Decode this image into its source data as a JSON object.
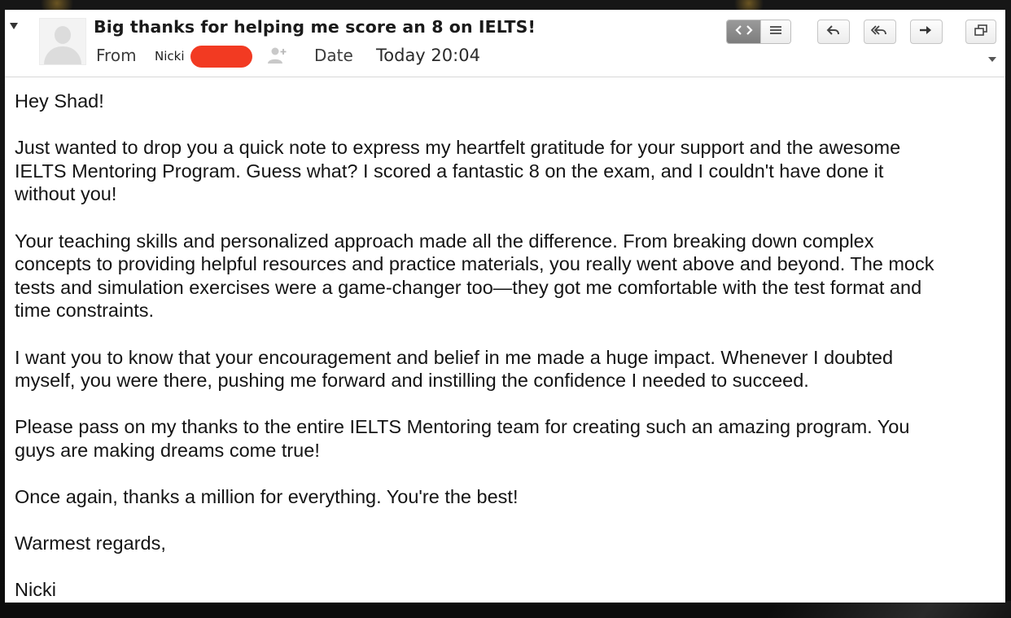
{
  "email": {
    "subject": "Big thanks for helping me score an 8 on IELTS!",
    "from_label": "From",
    "from_name": "Nicki",
    "date_label": "Date",
    "date_value": "Today 20:04"
  },
  "toolbar": {
    "buttons": [
      {
        "name": "toggle-source-view",
        "icon": "code-brackets-icon"
      },
      {
        "name": "view-menu",
        "icon": "hamburger-icon"
      },
      {
        "name": "reply",
        "icon": "reply-icon"
      },
      {
        "name": "reply-all",
        "icon": "reply-all-icon"
      },
      {
        "name": "forward",
        "icon": "forward-arrow-icon"
      },
      {
        "name": "open-in-window",
        "icon": "windows-icon"
      }
    ]
  },
  "message": {
    "paragraphs": [
      "Hey Shad!",
      "Just wanted to drop you a quick note to express my heartfelt gratitude for your support and the awesome\nIELTS Mentoring Program. Guess what? I scored a fantastic 8 on the exam, and I couldn't have done it\nwithout you!",
      "Your teaching skills and personalized approach made all the difference. From breaking down complex\nconcepts to providing helpful resources and practice materials, you really went above and beyond. The mock\ntests and simulation exercises were a game-changer too—they got me comfortable with the test format and\ntime constraints.",
      "I want you to know that your encouragement and belief in me made a huge impact. Whenever I doubted\nmyself, you were there, pushing me forward and instilling the confidence I needed to succeed.",
      "Please pass on my thanks to the entire IELTS Mentoring team for creating such an amazing program. You\nguys are making dreams come true!",
      "Once again, thanks a million for everything. You're the best!",
      "Warmest regards,",
      "Nicki"
    ]
  },
  "colors": {
    "redaction": "#f23a22",
    "selected_segment": "#8a8a8a",
    "background": "#121212"
  }
}
